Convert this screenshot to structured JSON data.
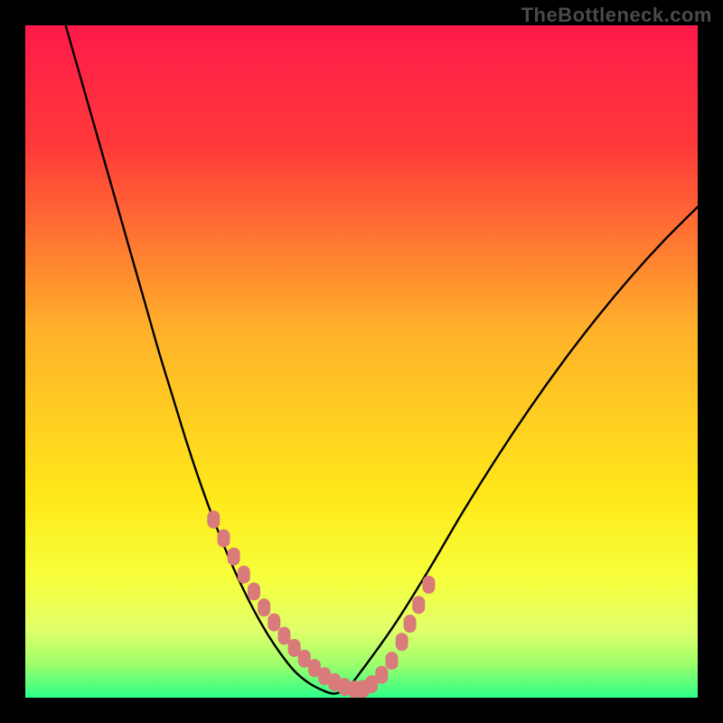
{
  "watermark": "TheBottleneck.com",
  "chart_data": {
    "type": "line",
    "title": "",
    "xlabel": "",
    "ylabel": "",
    "xlim": [
      0,
      100
    ],
    "ylim": [
      0,
      100
    ],
    "gradient_stops": [
      {
        "offset": 0.0,
        "color": "#ff1a4a"
      },
      {
        "offset": 0.18,
        "color": "#ff3a3a"
      },
      {
        "offset": 0.45,
        "color": "#ffb02a"
      },
      {
        "offset": 0.7,
        "color": "#ffe81a"
      },
      {
        "offset": 0.82,
        "color": "#f6ff3a"
      },
      {
        "offset": 0.9,
        "color": "#e0ff6a"
      },
      {
        "offset": 0.95,
        "color": "#9dff6a"
      },
      {
        "offset": 1.0,
        "color": "#2cff8a"
      }
    ],
    "series": [
      {
        "name": "bottleneck-curve",
        "x": [
          6,
          8,
          10,
          12,
          14,
          16,
          18,
          20,
          22,
          24,
          26,
          28,
          30,
          32,
          34,
          36,
          38,
          40,
          42,
          44,
          46,
          48,
          50,
          55,
          60,
          65,
          70,
          75,
          80,
          85,
          90,
          95,
          100
        ],
        "y": [
          100,
          93,
          86,
          79,
          72,
          65,
          58,
          51,
          44.5,
          38,
          32,
          26.5,
          21.5,
          17,
          13,
          9.5,
          6.5,
          4,
          2.3,
          1.2,
          0.6,
          1.6,
          4,
          11,
          19,
          27.5,
          35.5,
          43,
          50,
          56.5,
          62.5,
          68,
          73
        ]
      }
    ],
    "marker_points": {
      "name": "highlight-markers",
      "color": "#d97b7b",
      "x": [
        28,
        29.5,
        31,
        32.5,
        34,
        35.5,
        37,
        38.5,
        40,
        41.5,
        43,
        44.5,
        46,
        47.5,
        49,
        50.2,
        51.5,
        53,
        54.5,
        56,
        57.2,
        58.5,
        60
      ],
      "y": [
        26.5,
        23.7,
        21,
        18.3,
        15.8,
        13.4,
        11.2,
        9.2,
        7.4,
        5.8,
        4.4,
        3.2,
        2.3,
        1.6,
        1.2,
        1.3,
        2.0,
        3.4,
        5.5,
        8.3,
        11.0,
        13.8,
        16.8
      ]
    }
  }
}
